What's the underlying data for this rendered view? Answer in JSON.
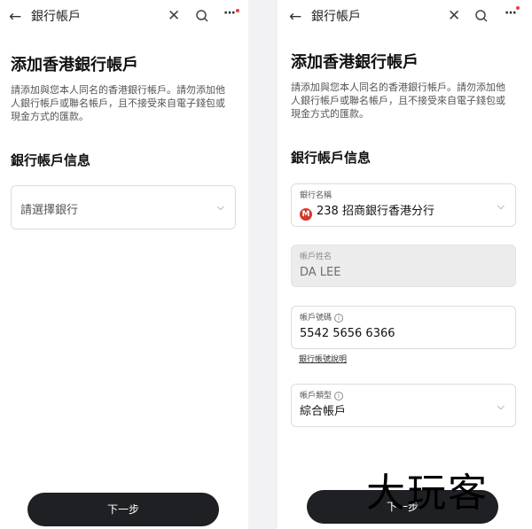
{
  "header": {
    "back_icon": "arrow-left-icon",
    "title": "銀行帳戶",
    "close_icon": "close-icon",
    "search_icon": "search-icon",
    "more_icon": "more-dots-icon",
    "notification_dot_color": "#e8413b"
  },
  "page": {
    "heading": "添加香港銀行帳戶",
    "description": "請添加與您本人同名的香港銀行帳戶。請勿添加他人銀行帳戶或聯名帳戶，且不接受來自電子錢包或現金方式的匯款。",
    "section_title": "銀行帳戶信息",
    "next_button": "下一步"
  },
  "left_screen": {
    "bank_select_placeholder": "請選擇銀行"
  },
  "right_screen": {
    "bank_name_label": "銀行名稱",
    "bank_name_value": "238 招商銀行香港分行",
    "bank_logo_color": "#d33a2c",
    "account_name_label": "帳戶姓名",
    "account_name_value": "DA LEE",
    "account_number_label": "帳戶號碼",
    "account_number_value": "5542 5656 6366",
    "account_number_help_link": "銀行帳號說明",
    "account_type_label": "帳戶類型",
    "account_type_value": "綜合帳戶"
  },
  "watermark": "大玩客"
}
